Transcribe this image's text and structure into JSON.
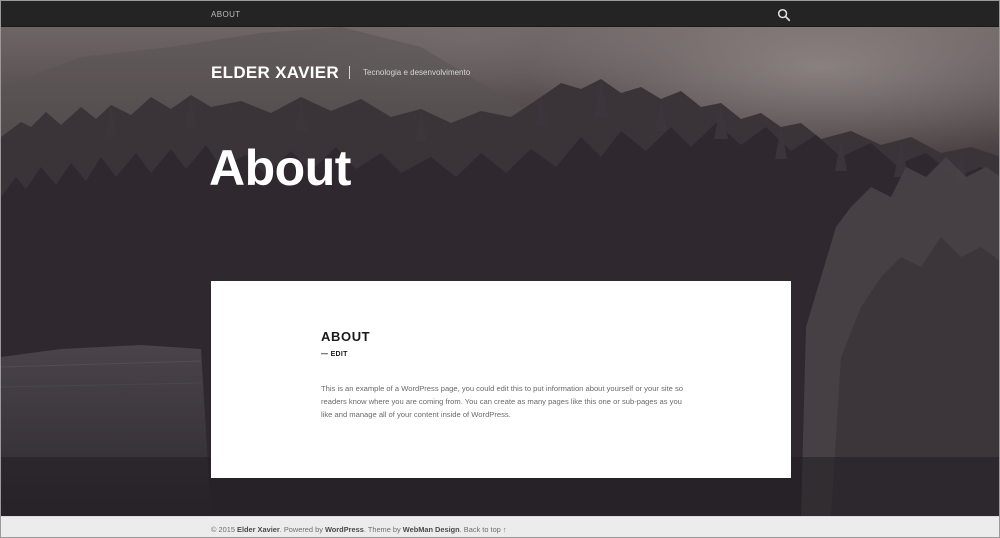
{
  "topbar": {
    "nav_about": "About",
    "search_icon": "search-icon"
  },
  "header": {
    "site_title": "ELDER XAVIER",
    "tagline": "Tecnologia e desenvolvimento"
  },
  "hero": {
    "page_title": "About"
  },
  "article": {
    "title": "ABOUT",
    "edit_prefix": "—",
    "edit_label": "EDIT",
    "body": "This is an example of a WordPress page, you could edit this to put information about yourself or your site so readers know where you are coming from. You can create as many pages like this one or sub-pages as you like and manage all of your content inside of WordPress."
  },
  "footer": {
    "copyright": "© 2015",
    "owner": "Elder Xavier",
    "powered_by": ". Powered by",
    "wordpress": "WordPress",
    "theme_by": ". Theme by",
    "theme_author": "WebMan Design",
    "back_to_top": ". Back to top ↑"
  },
  "colors": {
    "topbar": "#242424",
    "card": "#ffffff",
    "footer": "#ececec"
  }
}
